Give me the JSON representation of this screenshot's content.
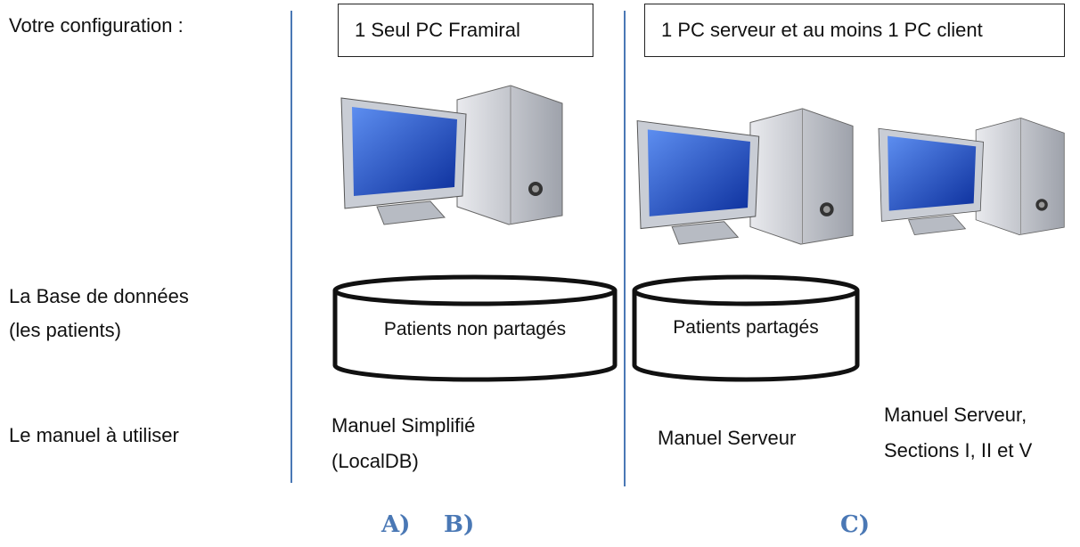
{
  "labels": {
    "config": "Votre configuration :",
    "database_line1": "La Base de données",
    "database_line2": "(les patients)",
    "manual": "Le manuel à utiliser"
  },
  "boxes": {
    "single": "1 Seul PC Framiral",
    "multi": "1 PC serveur et au moins 1 PC client"
  },
  "databases": {
    "not_shared": "Patients non partagés",
    "shared": "Patients partagés"
  },
  "manuals": {
    "simplified_line1": "Manuel Simplifié",
    "simplified_line2": "(LocalDB)",
    "server": "Manuel Serveur",
    "server_sections_line1": "Manuel Serveur,",
    "server_sections_line2": "Sections I, II et V"
  },
  "letters": {
    "a": "A)",
    "b": "B)",
    "c": "C)"
  },
  "colors": {
    "divider": "#4a78b5",
    "letter": "#4a78b5",
    "screen": "#1f55c9"
  },
  "icons": [
    "computer-icon",
    "database-icon"
  ]
}
